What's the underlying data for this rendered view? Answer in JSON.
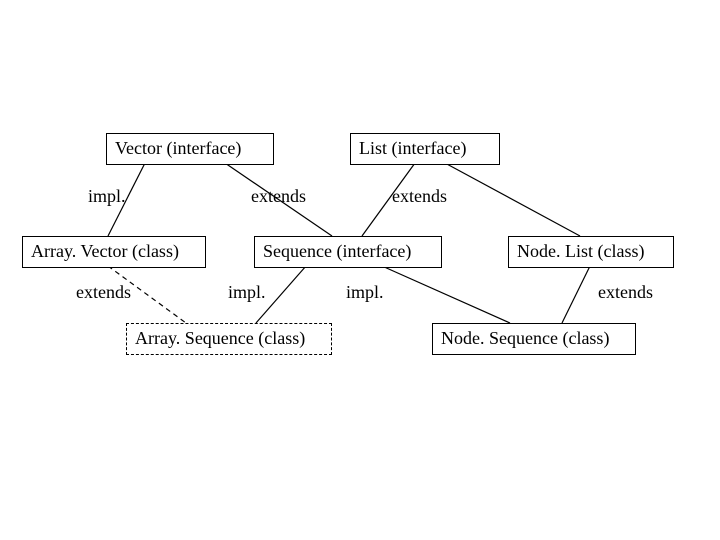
{
  "nodes": {
    "vector_iface": "Vector (interface)",
    "list_iface": "List (interface)",
    "array_vector": "Array. Vector (class)",
    "sequence_iface": "Sequence (interface)",
    "node_list": "Node. List (class)",
    "array_sequence": "Array. Sequence (class)",
    "node_sequence": "Node. Sequence (class)"
  },
  "labels": {
    "impl_vector_av": "impl.",
    "extends_vec_seq": "extends",
    "extends_list_seq": "extends",
    "extends_av_as": "extends",
    "impl_seq_as": "impl.",
    "impl_seq_ns": "impl.",
    "extends_nl_ns": "extends"
  }
}
